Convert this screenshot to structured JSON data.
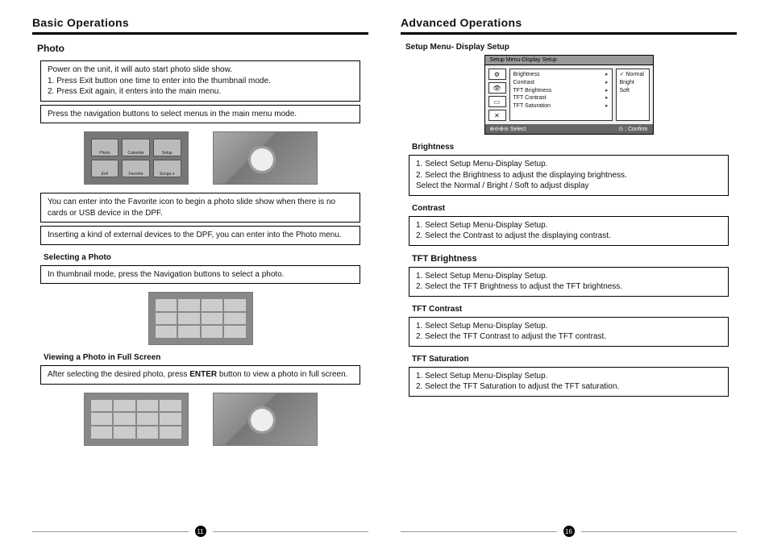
{
  "left": {
    "title": "Basic Operations",
    "section": "Photo",
    "box1": {
      "line0": "Power on the unit, it will auto start photo slide show.",
      "line1": "1. Press Exit button one time to enter into the thumbnail mode.",
      "line2": "2. Press Exit again, it enters into the main menu."
    },
    "box2": "Press the navigation buttons to select menus in the main menu mode.",
    "menu_icons": [
      "Photo",
      "Calendar",
      "Setup",
      "Exit",
      "Favorite",
      "Sunga e"
    ],
    "box3": "You can enter into the Favorite icon to begin a photo slide show when there is no cards or USB device in the DPF.",
    "box4": "Inserting a kind of external devices to the DPF, you can enter into the Photo menu.",
    "sub1": "Selecting a Photo",
    "box5": "In thumbnail mode, press the Navigation buttons to select a photo.",
    "sub2": "Viewing a Photo in Full Screen",
    "box6_a": "After selecting the desired photo, press",
    "box6_enter": "ENTER",
    "box6_b": "button to view a photo in full screen.",
    "page_num": "11"
  },
  "right": {
    "title": "Advanced Operations",
    "section": "Setup Menu- Display Setup",
    "setup_menu": {
      "title": "Setup Menu-Display Setup",
      "items": [
        "Brightness",
        "Contrast",
        "TFT Brightness",
        "TFT Contrast",
        "TFT Saturation"
      ],
      "options": [
        "Normal",
        "Bright",
        "Soft"
      ],
      "foot_left": "⊕⊖⊕⊖ Select",
      "foot_right": "⊙ : Confirm"
    },
    "brightness": {
      "title": "Brightness",
      "line1": "1. Select Setup Menu-Display Setup.",
      "line2": "2. Select the Brightness to adjust the displaying brightness.",
      "note": "Select the Normal / Bright / Soft to adjust display"
    },
    "contrast": {
      "title": "Contrast",
      "line1": "1. Select Setup Menu-Display Setup.",
      "line2": "2. Select the Contrast to adjust the displaying contrast."
    },
    "tft_brightness": {
      "title": "TFT Brightness",
      "line1": "1. Select Setup Menu-Display Setup.",
      "line2": "2. Select the TFT Brightness to adjust the TFT brightness."
    },
    "tft_contrast": {
      "title": "TFT Contrast",
      "line1": "1. Select Setup Menu-Display Setup.",
      "line2": "2. Select the TFT Contrast to adjust the TFT contrast."
    },
    "tft_saturation": {
      "title": "TFT Saturation",
      "line1": "1. Select Setup Menu-Display Setup.",
      "line2": "2. Select the TFT Saturation to adjust the TFT saturation."
    },
    "page_num": "16"
  }
}
